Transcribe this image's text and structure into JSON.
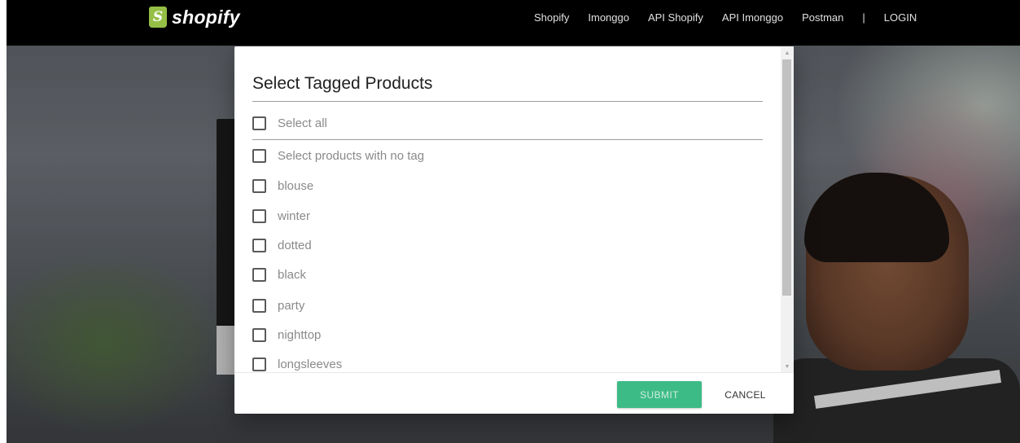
{
  "nav": {
    "logo_text": "shopify",
    "logo_mark": "S",
    "links": [
      "Shopify",
      "Imonggo",
      "API Shopify",
      "API Imonggo",
      "Postman"
    ],
    "separator": "|",
    "login": "LOGIN"
  },
  "modal": {
    "title": "Select Tagged Products",
    "select_all": "Select all",
    "options": [
      "Select products with no tag",
      "blouse",
      "winter",
      "dotted",
      "black",
      "party",
      "nighttop",
      "longsleeves"
    ],
    "submit": "SUBMIT",
    "cancel": "CANCEL"
  },
  "colors": {
    "accent": "#3dbb87",
    "nav_bg": "#000000",
    "brand_green": "#95bf47"
  },
  "icons": {
    "logo": "shopify-bag-icon",
    "scroll_up": "scroll-up-arrow-icon",
    "scroll_down": "scroll-down-arrow-icon"
  }
}
